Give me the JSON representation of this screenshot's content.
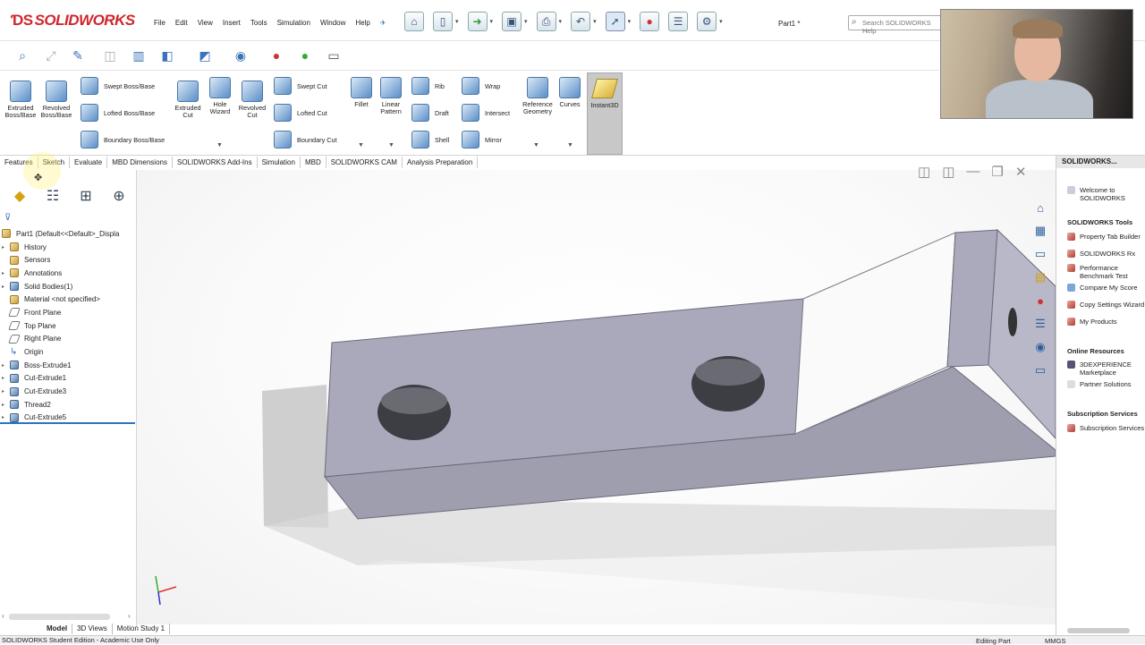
{
  "app": {
    "brand": "SOLIDWORKS",
    "part_name": "Part1 *"
  },
  "menu": [
    "File",
    "Edit",
    "View",
    "Insert",
    "Tools",
    "Simulation",
    "Window",
    "Help"
  ],
  "search": {
    "placeholder": "Search SOLIDWORKS Help"
  },
  "ribbon": {
    "extruded_boss": "Extruded Boss/Base",
    "revolved_boss": "Revolved Boss/Base",
    "swept_boss": "Swept Boss/Base",
    "lofted_boss": "Lofted Boss/Base",
    "boundary_boss": "Boundary Boss/Base",
    "extruded_cut": "Extruded Cut",
    "hole_wizard": "Hole Wizard",
    "revolved_cut": "Revolved Cut",
    "swept_cut": "Swept Cut",
    "lofted_cut": "Lofted Cut",
    "boundary_cut": "Boundary Cut",
    "fillet": "Fillet",
    "linear_pattern": "Linear Pattern",
    "rib": "Rib",
    "draft": "Draft",
    "shell": "Shell",
    "wrap": "Wrap",
    "intersect": "Intersect",
    "mirror": "Mirror",
    "reference_geometry": "Reference Geometry",
    "curves": "Curves",
    "instant3d": "Instant3D"
  },
  "command_tabs": [
    "Features",
    "Sketch",
    "Evaluate",
    "MBD Dimensions",
    "SOLIDWORKS Add-Ins",
    "Simulation",
    "MBD",
    "SOLIDWORKS CAM",
    "Analysis Preparation"
  ],
  "tree": {
    "root": "Part1  (Default<<Default>_Displa",
    "items": [
      "History",
      "Sensors",
      "Annotations",
      "Solid Bodies(1)",
      "Material <not specified>",
      "Front Plane",
      "Top Plane",
      "Right Plane",
      "Origin",
      "Boss-Extrude1",
      "Cut-Extrude1",
      "Cut-Extrude3",
      "Thread2",
      "Cut-Extrude5"
    ]
  },
  "bottom_tabs": [
    "Model",
    "3D Views",
    "Motion Study 1"
  ],
  "status": {
    "left": "SOLIDWORKS Student Edition - Academic Use Only",
    "editing": "Editing Part",
    "units": "MMGS"
  },
  "taskpane": {
    "title": "SOLIDWORKS...",
    "welcome": "Welcome to SOLIDWORKS",
    "tools_header": "SOLIDWORKS Tools",
    "tools": [
      "Property Tab Builder",
      "SOLIDWORKS Rx",
      "Performance Benchmark Test",
      "Compare My Score",
      "Copy Settings Wizard",
      "My Products"
    ],
    "online_header": "Online Resources",
    "online": [
      "3DEXPERIENCE Marketplace",
      "Partner Solutions"
    ],
    "subs_header": "Subscription Services",
    "subs": [
      "Subscription Services"
    ]
  }
}
